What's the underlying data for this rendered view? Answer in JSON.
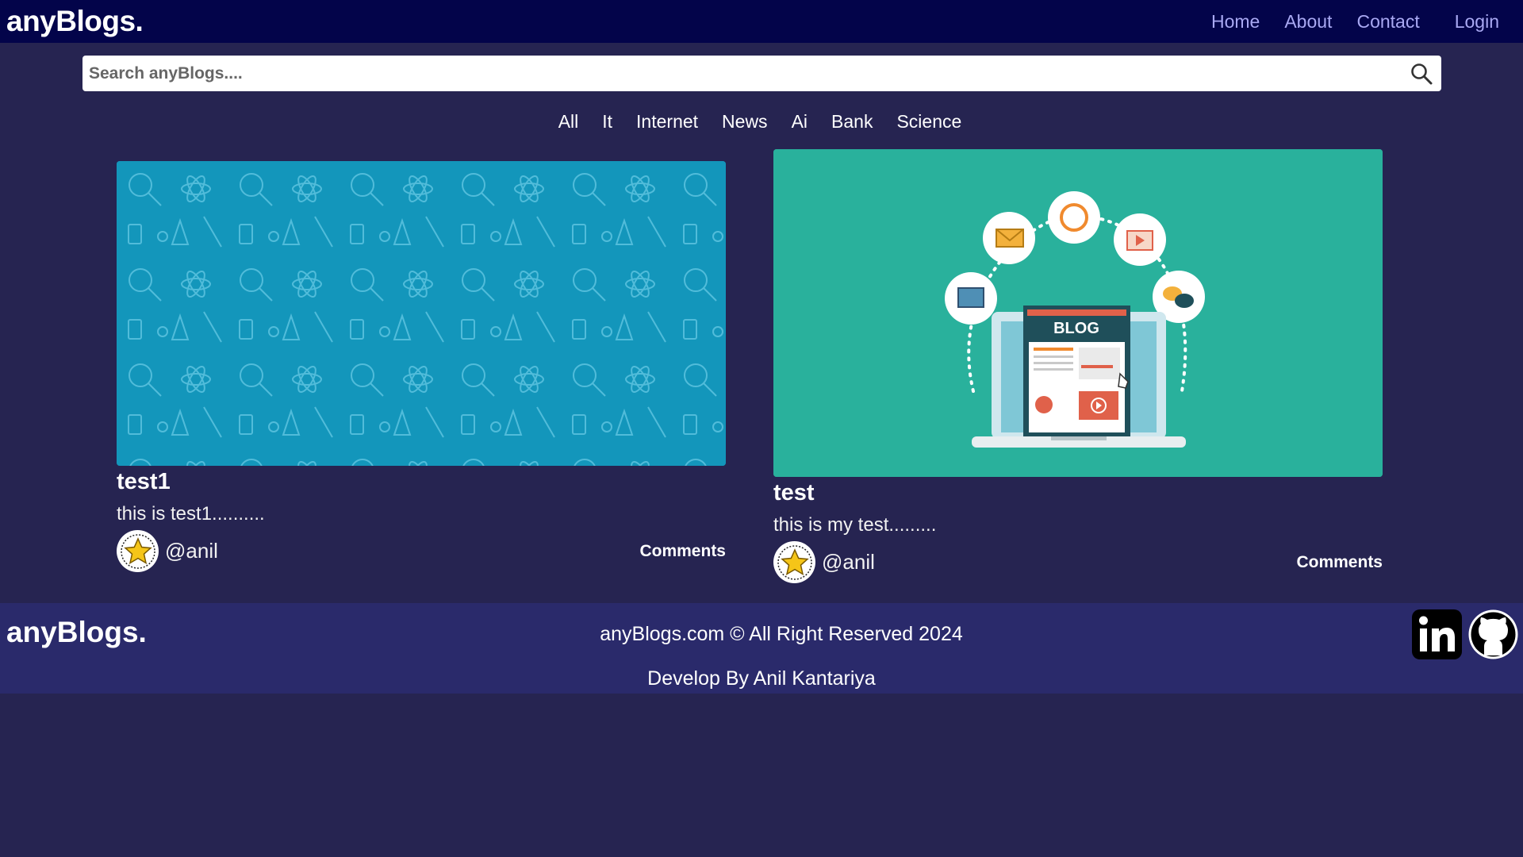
{
  "navbar": {
    "brand": "anyBlogs.",
    "links": {
      "home": "Home",
      "about": "About",
      "contact": "Contact",
      "login": "Login"
    }
  },
  "search": {
    "placeholder": "Search anyBlogs...."
  },
  "categories": [
    "All",
    "It",
    "Internet",
    "News",
    "Ai",
    "Bank",
    "Science"
  ],
  "posts": [
    {
      "title": "test1",
      "description": "this is test1..........",
      "author": "@anil",
      "comments_label": "Comments",
      "image": "science-pattern",
      "image_color": "#1396bb"
    },
    {
      "title": "test",
      "description": "this is my test.........",
      "author": "@anil",
      "comments_label": "Comments",
      "image": "blog-illustration",
      "image_color": "#29b19c"
    }
  ],
  "footer": {
    "brand": "anyBlogs.",
    "copyright": "anyBlogs.com © All Right Reserved 2024",
    "developer": "Develop By Anil Kantariya",
    "social": [
      "linkedin-icon",
      "github-icon"
    ]
  },
  "colors": {
    "background": "#262451",
    "navbar": "#03044a",
    "nav_link": "#a9a9f3",
    "footer": "#2a2a6b"
  }
}
